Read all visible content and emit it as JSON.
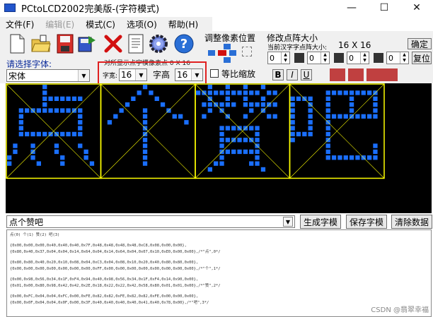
{
  "window": {
    "title": "PCtoLCD2002完美版-(字符模式)",
    "controls": [
      "—",
      "☐",
      "✕"
    ]
  },
  "menu": [
    {
      "label": "文件(F)",
      "disabled": false
    },
    {
      "label": "编辑(E)",
      "disabled": true
    },
    {
      "label": "模式(C)",
      "disabled": false
    },
    {
      "label": "选项(O)",
      "disabled": false
    },
    {
      "label": "帮助(H)",
      "disabled": false
    }
  ],
  "toolbar": {
    "icons": [
      "new-file-icon",
      "open-folder-icon",
      "save-floppy-icon",
      "save-as-icon",
      "delete-icon",
      "document-icon",
      "gear-icon",
      "help-icon"
    ]
  },
  "pixel_adjust": {
    "label": "调整像素位置"
  },
  "dot_size": {
    "label": "修改点阵大小",
    "width_label": "当前汉字字点阵大小:",
    "dims": "16 X 16",
    "confirm_button": "确定",
    "reset_button": "复位",
    "spin_values": [
      "0",
      "0",
      "0",
      "0"
    ]
  },
  "font": {
    "label": "请选择字体:",
    "selected": "宋体",
    "width_label": "字宽:",
    "width_value": "16",
    "height_label": "字高",
    "height_value": "16",
    "overlay_text": "对所显示点字模像素点 0 X 16",
    "proportional_label": "等比缩放",
    "style_buttons": [
      "B",
      "I",
      "U"
    ]
  },
  "canvas": {
    "bg": "#000000",
    "pixel_color": "#1a6fff",
    "grid_color": "#ffff00",
    "characters": [
      "点",
      "个",
      "赞",
      "吧"
    ]
  },
  "actions": {
    "input_text": "点个赞吧",
    "generate_button": "生成字模",
    "save_button": "保存字模",
    "clear_button": "清除数据"
  },
  "output": {
    "header": "点(0) 个(1) 赞(2) 吧(3)",
    "blocks": [
      [
        "{0x00,0x00,0x00,0x40,0x40,0x40,0x7F,0x48,0x48,0x48,0x48,0xC8,0x08,0x00,0x00},",
        "{0x80,0x40,0x37,0x04,0x04,0x14,0x64,0x04,0x14,0x64,0x04,0x07,0x10,0xE0,0x00,0x00},/*\"点\",0*/"
      ],
      [
        "{0x80,0x80,0x40,0x20,0x10,0x08,0x04,0xC3,0x04,0x08,0x10,0x20,0x40,0x80,0x80,0x00},",
        "{0x00,0x00,0x00,0x00,0x00,0x00,0x00,0xFF,0x00,0x00,0x00,0x00,0x00,0x00,0x00,0x00},/*\"个\",1*/"
      ],
      [
        "{0x00,0x98,0x56,0x34,0x1F,0xF4,0x94,0x40,0x98,0x56,0x34,0x1F,0xF4,0x14,0x90,0x00},",
        "{0x01,0x00,0x80,0x98,0x42,0x42,0x2E,0x18,0x22,0x22,0x42,0x58,0x80,0x01,0x01,0x00},/*\"赞\",2*/"
      ],
      [
        "{0x00,0xFC,0x04,0x04,0xFC,0x00,0xFE,0x82,0x82,0xFE,0x82,0x82,0xFE,0x00,0x00,0x00},",
        "{0x00,0x0F,0x04,0x04,0x0F,0x00,0x3F,0x40,0x40,0x40,0x40,0x41,0x40,0x78,0x00},/*\"吧\",3*/"
      ]
    ]
  },
  "watermark": "CSDN @翡翠幸福"
}
